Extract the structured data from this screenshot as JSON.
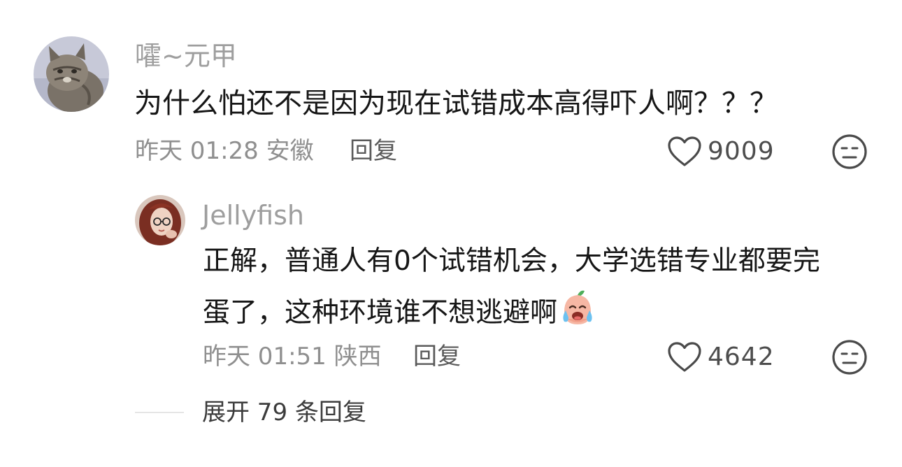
{
  "comments": [
    {
      "username": "嚯~元甲",
      "text": "为什么怕还不是因为现在试错成本高得吓人啊？？？",
      "time": "昨天 01:28",
      "location": "安徽",
      "reply_label": "回复",
      "likes": "9009",
      "like_icon": "heart-icon",
      "dislike_icon": "neutral-face-icon",
      "avatar": "cat-avatar"
    }
  ],
  "replies": [
    {
      "username": "Jellyfish",
      "text_line1": "正解，普通人有0个试错机会，大学选错专业都要完",
      "text_line2": "蛋了，这种环境谁不想逃避啊",
      "emoji": "crying-peach-emoji",
      "time": "昨天 01:51",
      "location": "陕西",
      "reply_label": "回复",
      "likes": "4642",
      "like_icon": "heart-icon",
      "dislike_icon": "neutral-face-icon",
      "avatar": "woman-avatar"
    }
  ],
  "expand": {
    "label": "展开 79 条回复"
  },
  "colors": {
    "username": "#9e9e9e",
    "text": "#161616",
    "meta": "#8f8f8f"
  }
}
